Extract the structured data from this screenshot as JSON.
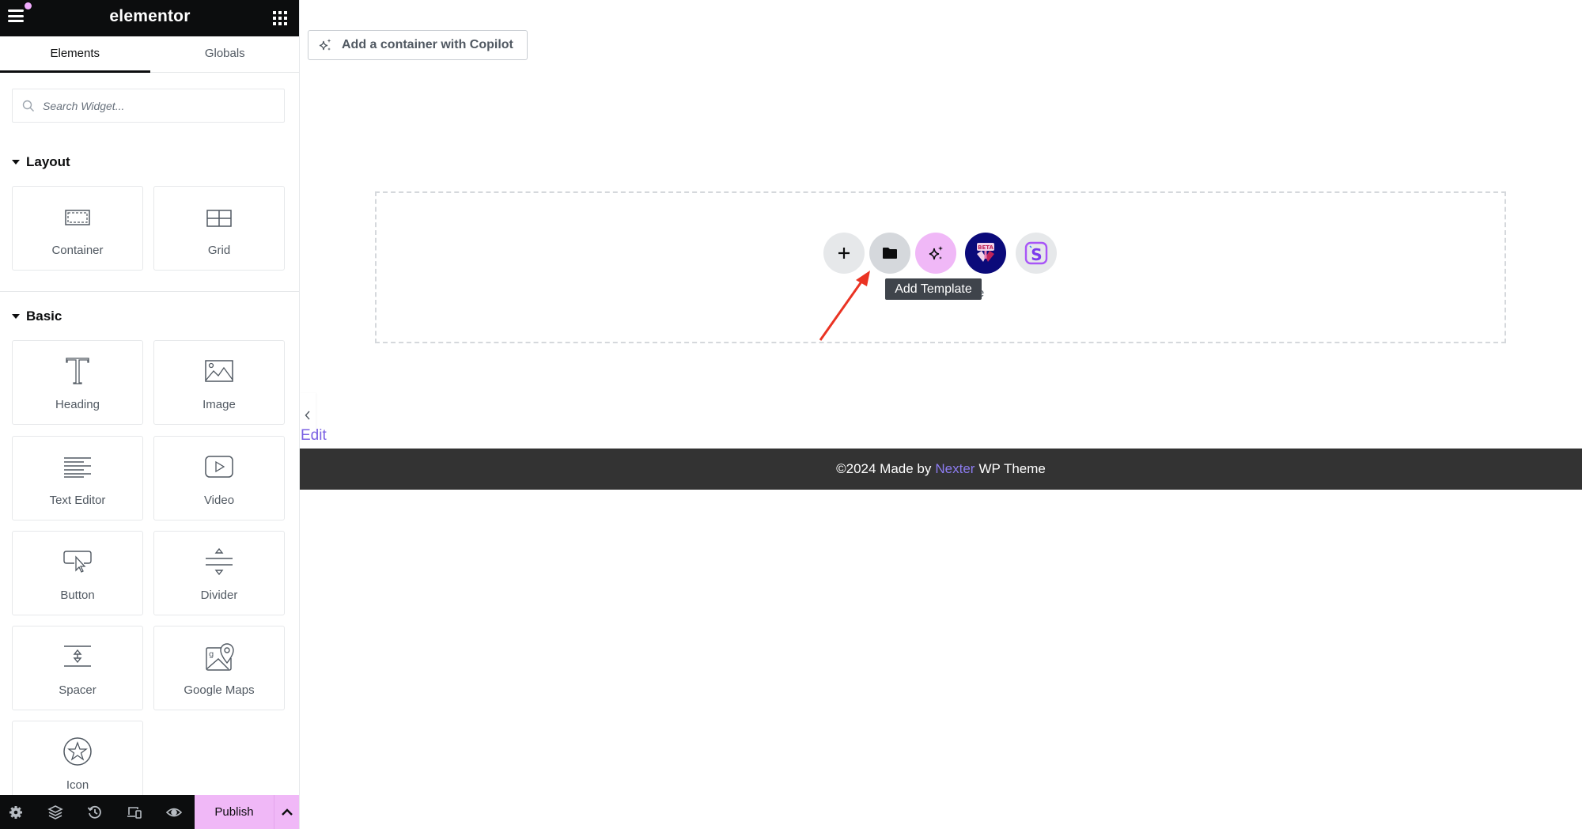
{
  "app": {
    "logo_text": "elementor",
    "notification_color": "#f0abfc"
  },
  "tabs": [
    {
      "label": "Elements",
      "active": true
    },
    {
      "label": "Globals",
      "active": false
    }
  ],
  "search": {
    "placeholder": "Search Widget...",
    "value": ""
  },
  "sections": [
    {
      "title": "Layout",
      "widgets": [
        {
          "label": "Container",
          "icon": "container-icon"
        },
        {
          "label": "Grid",
          "icon": "grid-icon"
        }
      ]
    },
    {
      "title": "Basic",
      "widgets": [
        {
          "label": "Heading",
          "icon": "heading-icon"
        },
        {
          "label": "Image",
          "icon": "image-icon"
        },
        {
          "label": "Text Editor",
          "icon": "text-editor-icon"
        },
        {
          "label": "Video",
          "icon": "video-icon"
        },
        {
          "label": "Button",
          "icon": "button-icon"
        },
        {
          "label": "Divider",
          "icon": "divider-icon"
        },
        {
          "label": "Spacer",
          "icon": "spacer-icon"
        },
        {
          "label": "Google Maps",
          "icon": "google-maps-icon"
        },
        {
          "label": "Icon",
          "icon": "star-icon"
        }
      ]
    }
  ],
  "bottom_bar": {
    "icons": [
      "settings-icon",
      "layers-icon",
      "history-icon",
      "responsive-icon",
      "preview-icon"
    ],
    "publish_label": "Publish",
    "publish_color": "#f0b8f7"
  },
  "canvas": {
    "copilot_button_label": "Add a container with Copilot",
    "dropzone_buttons": [
      {
        "name": "add-section",
        "icon": "plus-icon",
        "bg": "#e6e8ea"
      },
      {
        "name": "add-template",
        "icon": "folder-icon",
        "bg": "#d5d8dc"
      },
      {
        "name": "ai-generate",
        "icon": "sparkle-icon",
        "bg": "#f0b8f7"
      },
      {
        "name": "beta-addon",
        "icon": "beta-icon",
        "bg": "#0b0a7a"
      },
      {
        "name": "s-addon",
        "icon": "s-icon",
        "bg": "#e6e8ea"
      }
    ],
    "drag_text": "Drag widget here",
    "tooltip": "Add Template",
    "edit_link": "Edit"
  },
  "footer": {
    "prefix": "©2024 Made by",
    "link": "Nexter",
    "suffix": "WP Theme",
    "link_color": "#8c7cf0"
  }
}
